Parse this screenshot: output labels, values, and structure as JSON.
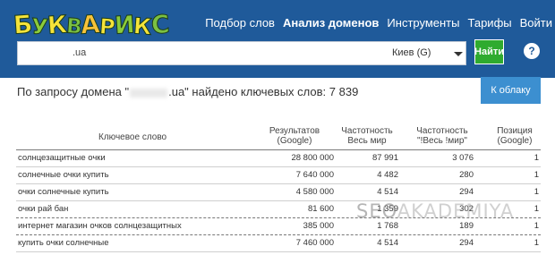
{
  "header": {
    "logo": {
      "text": "БУКВАРИКС",
      "letters": [
        {
          "ch": "Б",
          "color": "#f5e33a"
        },
        {
          "ch": "У",
          "color": "#8bcb3b"
        },
        {
          "ch": "К",
          "color": "#f5e33a"
        },
        {
          "ch": "В",
          "color": "#7bc043"
        },
        {
          "ch": "А",
          "color": "#f7c23a"
        },
        {
          "ch": "Р",
          "color": "#f5e33a"
        },
        {
          "ch": "И",
          "color": "#8bcb3b"
        },
        {
          "ch": "К",
          "color": "#f5e33a"
        },
        {
          "ch": "С",
          "color": "#7bc043"
        }
      ]
    },
    "nav": [
      {
        "label": "Подбор слов",
        "name": "nav-keyword-selection",
        "active": false
      },
      {
        "label": "Анализ доменов",
        "name": "nav-domain-analysis",
        "active": true
      },
      {
        "label": "Инструменты",
        "name": "nav-tools",
        "active": false
      },
      {
        "label": "Тарифы",
        "name": "nav-pricing",
        "active": false
      },
      {
        "label": "Войти",
        "name": "nav-login",
        "active": false
      }
    ]
  },
  "search": {
    "value": ".ua",
    "region": "Киев (G)",
    "button": "Найти",
    "help": "?"
  },
  "summary": {
    "prefix": "По запросу домена \"",
    "domain_suffix": ".ua\"",
    "middle": " найдено ключевых слов: ",
    "count": "7 839"
  },
  "cloud_button": "К облаку",
  "table": {
    "headers": {
      "keyword": "Ключевое слово",
      "results": "Результатов\n(Google)",
      "worldwide": "Частотность\nВесь мир",
      "exact": "Частотность\n\"!Весь !мир\"",
      "position": "Позиция\n(Google)"
    },
    "rows": [
      {
        "keyword": "солнцезащитные очки",
        "results": "28 800 000",
        "worldwide": "87 991",
        "exact": "3 076",
        "position": "1"
      },
      {
        "keyword": "солнечные очки купить",
        "results": "7 640 000",
        "worldwide": "4 482",
        "exact": "280",
        "position": "1"
      },
      {
        "keyword": "очки солнечные купить",
        "results": "4 580 000",
        "worldwide": "4 514",
        "exact": "294",
        "position": "1"
      },
      {
        "keyword": "очки рай бан",
        "results": "81 600",
        "worldwide": "1 359",
        "exact": "302",
        "position": "1"
      },
      {
        "keyword": "интернет магазин очков солнцезащитных",
        "results": "385 000",
        "worldwide": "1 768",
        "exact": "189",
        "position": "1"
      },
      {
        "keyword": "купить очки солнечные",
        "results": "7 460 000",
        "worldwide": "4 514",
        "exact": "294",
        "position": "1"
      }
    ]
  },
  "watermark": {
    "part1": "SEO",
    "part2": "AKADEMIYA"
  }
}
